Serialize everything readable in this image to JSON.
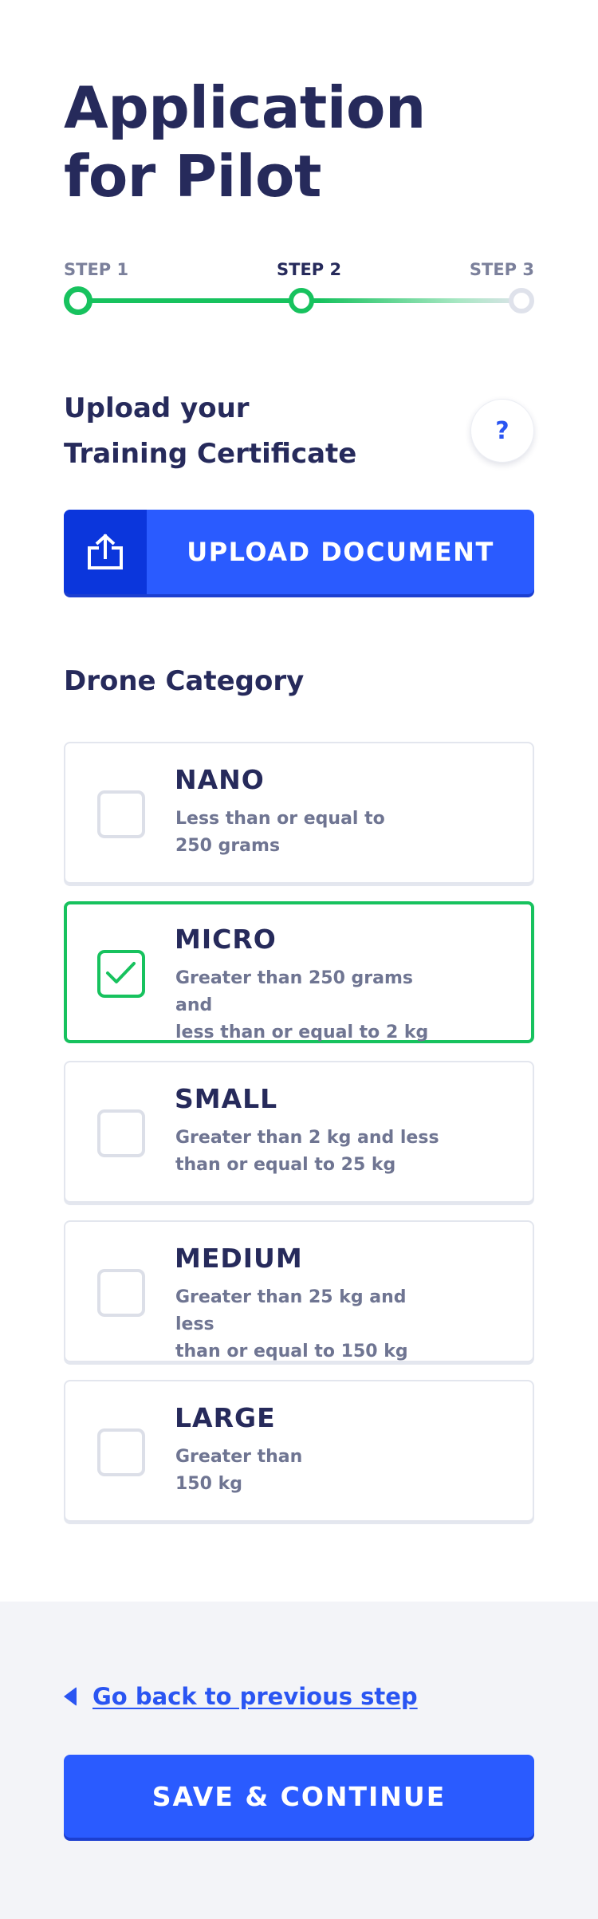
{
  "title_line1": "Application",
  "title_line2": "for Pilot",
  "stepper": {
    "steps": [
      {
        "label": "STEP 1",
        "state": "complete"
      },
      {
        "label": "STEP 2",
        "state": "current"
      },
      {
        "label": "STEP 3",
        "state": "upcoming"
      }
    ],
    "progress_percent": 50
  },
  "upload": {
    "heading_line1": "Upload your",
    "heading_line2": "Training Certificate",
    "help_label": "?",
    "button_label": "UPLOAD DOCUMENT",
    "icon": "upload-icon"
  },
  "category": {
    "title": "Drone Category",
    "selected": "MICRO",
    "options": [
      {
        "name": "NANO",
        "desc_line1": "Less than or equal to",
        "desc_line2": "250 grams",
        "checked": false
      },
      {
        "name": "MICRO",
        "desc_line1": "Greater than 250 grams and",
        "desc_line2": "less than or equal to 2 kg",
        "checked": true
      },
      {
        "name": "SMALL",
        "desc_line1": "Greater than 2 kg and less",
        "desc_line2": "than or equal to 25 kg",
        "checked": false
      },
      {
        "name": "MEDIUM",
        "desc_line1": "Greater than 25 kg and less",
        "desc_line2": "than or equal to 150 kg",
        "checked": false
      },
      {
        "name": "LARGE",
        "desc_line1": "Greater than",
        "desc_line2": "150 kg",
        "checked": false
      }
    ]
  },
  "footer": {
    "back_label": "Go back to previous step",
    "save_label": "SAVE & CONTINUE"
  },
  "colors": {
    "primary": "#2a5bff",
    "primary_dark": "#0b36dc",
    "success": "#17c25e",
    "heading": "#262a5b",
    "muted": "#6f7592"
  }
}
